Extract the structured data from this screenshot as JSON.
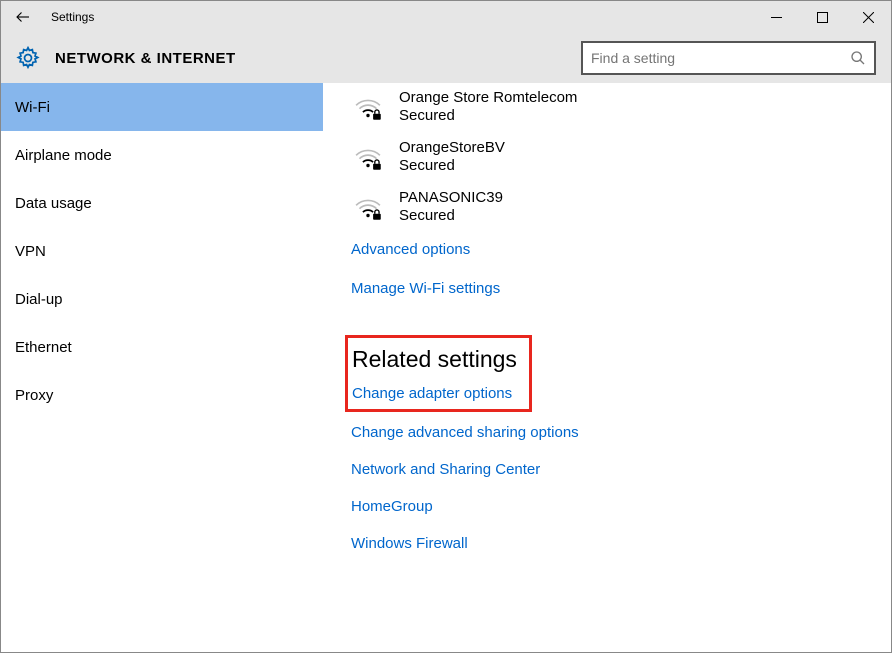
{
  "window": {
    "title": "Settings"
  },
  "header": {
    "heading": "NETWORK & INTERNET",
    "search_placeholder": "Find a setting"
  },
  "sidebar": {
    "items": [
      {
        "label": "Wi-Fi",
        "selected": true
      },
      {
        "label": "Airplane mode",
        "selected": false
      },
      {
        "label": "Data usage",
        "selected": false
      },
      {
        "label": "VPN",
        "selected": false
      },
      {
        "label": "Dial-up",
        "selected": false
      },
      {
        "label": "Ethernet",
        "selected": false
      },
      {
        "label": "Proxy",
        "selected": false
      }
    ]
  },
  "main": {
    "networks": [
      {
        "name": "Orange Store Romtelecom",
        "status": "Secured"
      },
      {
        "name": "OrangeStoreBV",
        "status": "Secured"
      },
      {
        "name": "PANASONIC39",
        "status": "Secured"
      }
    ],
    "links": [
      "Advanced options",
      "Manage Wi-Fi settings"
    ],
    "related_heading": "Related settings",
    "related_links": [
      "Change adapter options",
      "Change advanced sharing options",
      "Network and Sharing Center",
      "HomeGroup",
      "Windows Firewall"
    ]
  }
}
